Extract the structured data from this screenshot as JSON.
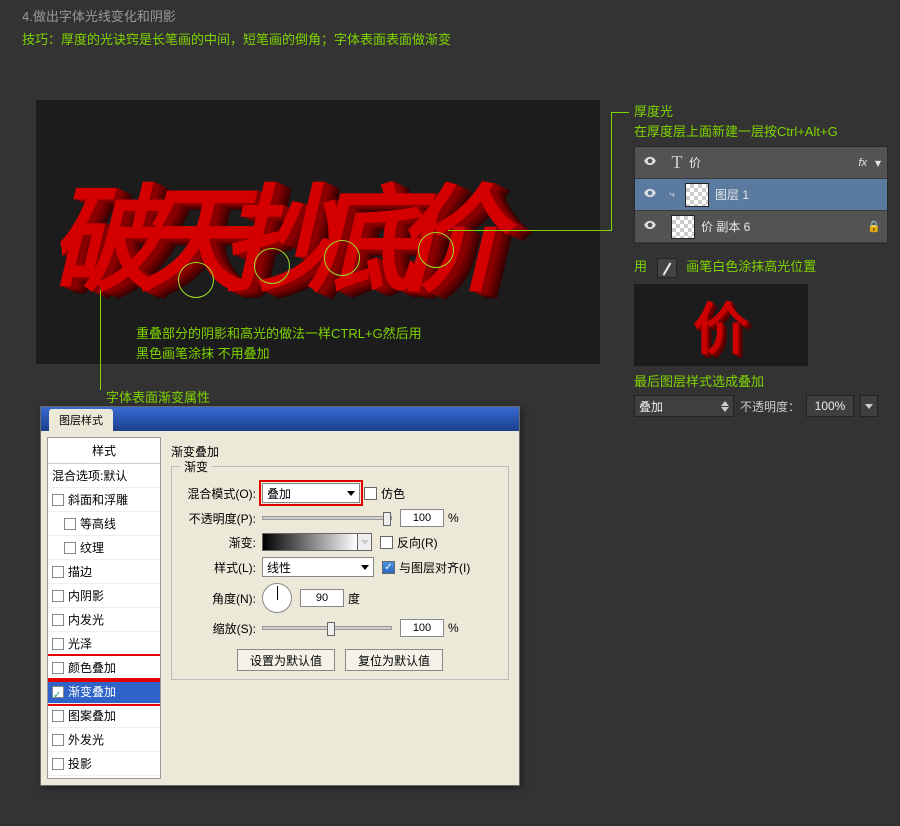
{
  "step_title": "4.做出字体光线变化和阴影",
  "tip": "技巧：厚度的光诀窍是长笔画的中间，短笔画的倒角；字体表面表面做渐变",
  "red_text": "破天抄底价",
  "annot": {
    "overlap_l1": "重叠部分的阴影和高光的做法一样CTRL+G然后用",
    "overlap_l2": "黑色画笔涂抹 不用叠加",
    "gradprop": "字体表面渐变属性",
    "thick_title": "厚度光",
    "thick_sub": "在厚度层上面新建一层按Ctrl+Alt+G",
    "brush_prefix": "用",
    "brush_suffix": "画笔白色涂抹高光位置",
    "final_blend": "最后图层样式选成叠加"
  },
  "layers": {
    "row1_name": "价",
    "row1_fx": "fx",
    "row2_name": "图层 1",
    "row3_name": "价 副本 6"
  },
  "blend": {
    "mode": "叠加",
    "opacity_label": "不透明度：",
    "opacity_value": "100%"
  },
  "mini_char": "价",
  "dialog": {
    "title_tab": "图层样式",
    "styles_head": "样式",
    "blend_default": "混合选项:默认",
    "item_bevel": "斜面和浮雕",
    "item_contour": "等高线",
    "item_texture": "纹理",
    "item_stroke": "描边",
    "item_innershadow": "内阴影",
    "item_innerglow": "内发光",
    "item_satin": "光泽",
    "item_coloroverlay": "颜色叠加",
    "item_gradoverlay": "渐变叠加",
    "item_patternoverlay": "图案叠加",
    "item_outerglow": "外发光",
    "item_dropshadow": "投影",
    "group_title": "渐变叠加",
    "legend": "渐变",
    "lbl_blendmode": "混合模式(O):",
    "val_blendmode": "叠加",
    "lbl_dither": "仿色",
    "lbl_opacity": "不透明度(P):",
    "val_opacity": "100",
    "lbl_gradient": "渐变:",
    "lbl_reverse": "反向(R)",
    "lbl_style": "样式(L):",
    "val_style": "线性",
    "lbl_align": "与图层对齐(I)",
    "lbl_angle": "角度(N):",
    "val_angle": "90",
    "lbl_degree": "度",
    "lbl_scale": "缩放(S):",
    "val_scale": "100",
    "btn_default": "设置为默认值",
    "btn_reset": "复位为默认值",
    "pct": "%"
  }
}
